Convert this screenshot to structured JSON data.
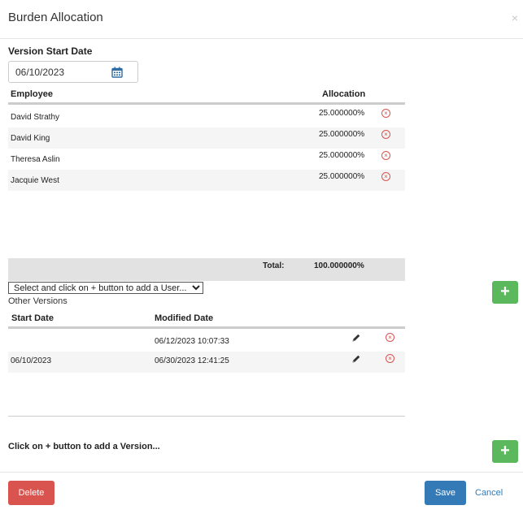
{
  "dialog": {
    "title": "Burden Allocation",
    "close_glyph": "×"
  },
  "version_start": {
    "label": "Version Start Date",
    "value": "06/10/2023",
    "icon": "calendar-icon"
  },
  "allocation_grid": {
    "headers": {
      "employee": "Employee",
      "allocation": "Allocation"
    },
    "rows": [
      {
        "employee": "David Strathy",
        "allocation": "25.000000%"
      },
      {
        "employee": "David King",
        "allocation": "25.000000%"
      },
      {
        "employee": "Theresa Aslin",
        "allocation": "25.000000%"
      },
      {
        "employee": "Jacquie West",
        "allocation": "25.000000%"
      }
    ],
    "delete_glyph": "×",
    "total_label": "Total:",
    "total_value": "100.000000%"
  },
  "user_select": {
    "selected": "Select and click on + button to add a User..."
  },
  "add_button_glyph": "+",
  "other_versions": {
    "label": "Other Versions",
    "headers": {
      "start_date": "Start Date",
      "modified_date": "Modified Date"
    },
    "rows": [
      {
        "start_date": "",
        "modified_date": "06/12/2023 10:07:33"
      },
      {
        "start_date": "06/10/2023",
        "modified_date": "06/30/2023 12:41:25"
      }
    ],
    "add_version_label": "Click on + button to add a Version..."
  },
  "footer": {
    "delete": "Delete",
    "save": "Save",
    "cancel": "Cancel"
  },
  "colors": {
    "danger": "#d9534f",
    "primary": "#337ab7",
    "success": "#5cb85c",
    "calendar": "#2e6da4"
  }
}
